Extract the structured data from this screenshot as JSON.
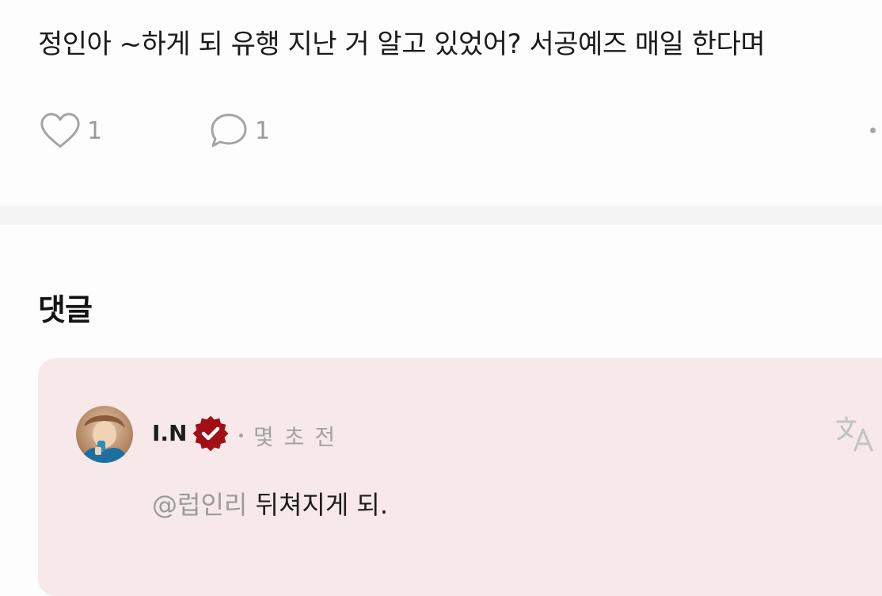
{
  "post": {
    "text": "정인아 ~하게 되 유행 지난 거 알고 있었어? 서공예즈 매일 한다며",
    "like_count": "1",
    "comment_count": "1",
    "like_icon": "heart-outline-icon",
    "comment_icon": "speech-bubble-icon"
  },
  "comments_section": {
    "title": "댓글"
  },
  "comment": {
    "username": "I.N",
    "verified_badge": "verified-badge-icon",
    "timestamp": "몇 초 전",
    "mention": "@럽인리",
    "body": " 뒤쳐지게 되.",
    "translate_icon": "translate-icon"
  },
  "colors": {
    "card_background": "#f7e9ea",
    "verified_badge": "#a10f14",
    "muted_text": "#9a9a9a",
    "divider": "#f4f4f4"
  }
}
